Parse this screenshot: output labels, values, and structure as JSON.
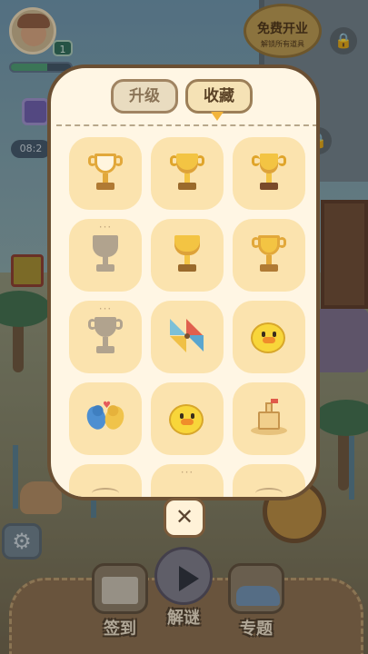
{
  "hud": {
    "level": "1",
    "xp_progress": 0.6,
    "timer": "08:2",
    "promo_title": "免费开业",
    "promo_subtitle": "解锁所有道具"
  },
  "modal": {
    "tabs": [
      {
        "label": "升级",
        "active": false
      },
      {
        "label": "收藏",
        "active": true
      }
    ],
    "items": [
      {
        "icon": "white-trophy-icon",
        "locked": false
      },
      {
        "icon": "gold-trophy-icon",
        "locked": false
      },
      {
        "icon": "gold-trophy-icon",
        "locked": false
      },
      {
        "icon": "grey-trophy-icon",
        "locked": true
      },
      {
        "icon": "gold-trophy-icon",
        "locked": false
      },
      {
        "icon": "white-trophy-icon",
        "locked": false
      },
      {
        "icon": "grey-trophy-icon",
        "locked": true
      },
      {
        "icon": "pinwheel-icon",
        "locked": false
      },
      {
        "icon": "rubber-duck-icon",
        "locked": false
      },
      {
        "icon": "lovebirds-icon",
        "locked": false
      },
      {
        "icon": "rubber-duck-icon",
        "locked": false
      },
      {
        "icon": "sandcastle-icon",
        "locked": false
      }
    ],
    "close_symbol": "✕"
  },
  "bottom_nav": {
    "sign_in": "签到",
    "puzzle": "解谜",
    "topic": "专题"
  },
  "colors": {
    "panel_bg": "#fff6e4",
    "cell_bg": "#fbe3ae",
    "border": "#6a4f33",
    "accent": "#f2b43b"
  }
}
